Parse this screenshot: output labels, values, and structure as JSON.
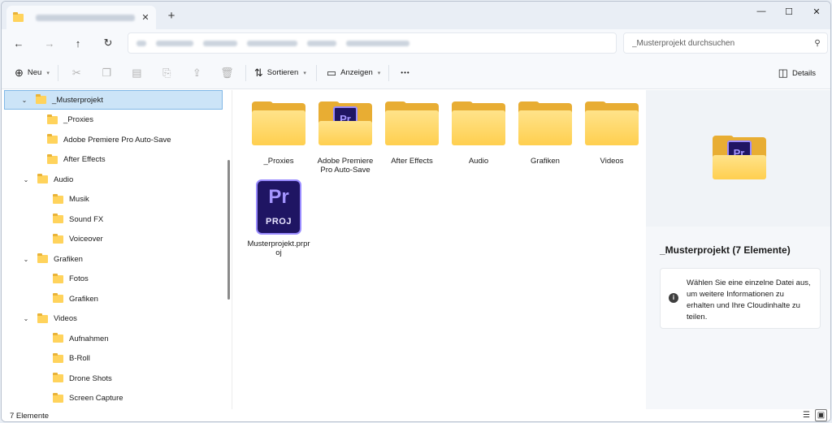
{
  "window": {
    "tab_close": "✕",
    "new_tab": "+",
    "minimize": "—",
    "maximize": "☐",
    "close": "✕"
  },
  "nav": {
    "back": "←",
    "forward": "→",
    "up": "↑",
    "refresh": "↻"
  },
  "search": {
    "placeholder": "_Musterprojekt durchsuchen",
    "icon": "⚲"
  },
  "toolbar": {
    "new_label": "Neu",
    "sort_label": "Sortieren",
    "view_label": "Anzeigen",
    "more_label": "•••",
    "details_label": "Details"
  },
  "sidebar": {
    "items": [
      {
        "label": "_Musterprojekt",
        "chevron": "⌄",
        "level": 0,
        "selected": true
      },
      {
        "label": "_Proxies",
        "chevron": "",
        "level": 1
      },
      {
        "label": "Adobe Premiere Pro Auto-Save",
        "chevron": "",
        "level": 1
      },
      {
        "label": "After Effects",
        "chevron": "",
        "level": 1
      },
      {
        "label": "Audio",
        "chevron": "⌄",
        "level": 1
      },
      {
        "label": "Musik",
        "chevron": "",
        "level": 2
      },
      {
        "label": "Sound FX",
        "chevron": "",
        "level": 2
      },
      {
        "label": "Voiceover",
        "chevron": "",
        "level": 2
      },
      {
        "label": "Grafiken",
        "chevron": "⌄",
        "level": 1
      },
      {
        "label": "Fotos",
        "chevron": "",
        "level": 2
      },
      {
        "label": "Grafiken",
        "chevron": "",
        "level": 2
      },
      {
        "label": "Videos",
        "chevron": "⌄",
        "level": 1
      },
      {
        "label": "Aufnahmen",
        "chevron": "",
        "level": 2
      },
      {
        "label": "B-Roll",
        "chevron": "",
        "level": 2
      },
      {
        "label": "Drone Shots",
        "chevron": "",
        "level": 2
      },
      {
        "label": "Screen Capture",
        "chevron": "",
        "level": 2
      }
    ]
  },
  "files": [
    {
      "label": "_Proxies",
      "type": "folder"
    },
    {
      "label": "Adobe Premiere Pro Auto-Save",
      "type": "folder-premiere"
    },
    {
      "label": "After Effects",
      "type": "folder"
    },
    {
      "label": "Audio",
      "type": "folder"
    },
    {
      "label": "Grafiken",
      "type": "folder"
    },
    {
      "label": "Videos",
      "type": "folder"
    },
    {
      "label": "Musterprojekt.prproj",
      "type": "prproj"
    }
  ],
  "icon_text": {
    "pr": "Pr",
    "proj": "PROJ"
  },
  "details": {
    "title": "_Musterprojekt (7 Elemente)",
    "info_icon": "i",
    "info_text": "Wählen Sie eine einzelne Datei aus, um weitere Informationen zu erhalten und Ihre Cloudinhalte zu teilen."
  },
  "status": {
    "count": "7 Elemente"
  },
  "colors": {
    "selection": "#cce4f7",
    "folder": "#ffd35c",
    "premiere": "#1f1563"
  }
}
